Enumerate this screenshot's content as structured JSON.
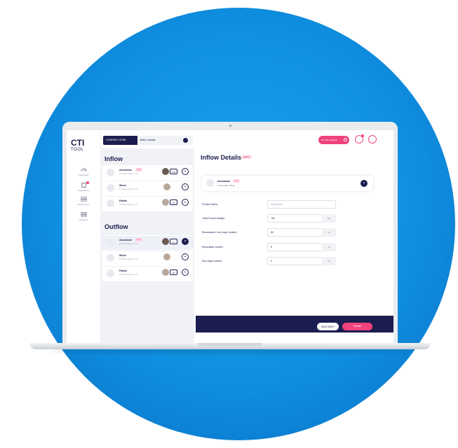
{
  "app": {
    "logo_line1": "CTI",
    "logo_line2": "TOOL"
  },
  "sidebar": {
    "items": [
      {
        "label": "Dashboard",
        "icon": "dashboard-icon"
      },
      {
        "label": "Organization",
        "icon": "organization-icon"
      },
      {
        "label": "Carbon flows",
        "icon": "flows-icon"
      },
      {
        "label": "Suppliers",
        "icon": "suppliers-icon"
      }
    ]
  },
  "header": {
    "company_level_label": "COMPANY LEVEL",
    "company_name": "Batio Graafas",
    "support_label": "Provide feedback",
    "colors": {
      "navy": "#1c1d4f",
      "pink": "#f0437e"
    }
  },
  "inflow": {
    "title": "Inflow",
    "items": [
      {
        "name": "Aluminium",
        "draft": "DRAFT",
        "meta": "15 shared views, 2 min",
        "count": "2016"
      },
      {
        "name": "Wood",
        "meta": "15 shared views, 2 min"
      },
      {
        "name": "Plastic",
        "meta": "15 shared views, 2 min",
        "count": "56"
      }
    ]
  },
  "outflow": {
    "title": "Outflow",
    "items": [
      {
        "name": "Aluminium",
        "draft": "DRAFT",
        "meta": "15 shared views, 2 min",
        "count": "14"
      },
      {
        "name": "Wood",
        "meta": "15 shared views, 2 min"
      },
      {
        "name": "Plastic",
        "meta": "15 shared views, 2 min",
        "count": "56"
      }
    ]
  },
  "detail": {
    "title": "Inflow Details",
    "badge": "DRAFT",
    "selected": {
      "name": "Aluminium",
      "draft": "DRAFT",
      "meta": "Total weight: 750 kg"
    },
    "fields": [
      {
        "label": "Product Name",
        "value": "Aluminium",
        "unit": ""
      },
      {
        "label": "Total Product Weight",
        "value": "750",
        "unit": "KG"
      },
      {
        "label": "Renewable & non virgin content",
        "value": "80",
        "unit": "%"
      },
      {
        "label": "Recyclable content",
        "value": "5",
        "unit": "%"
      },
      {
        "label": "Non virgin content",
        "value": "0",
        "unit": "%"
      }
    ],
    "save_label": "SAVE DRAFT",
    "publish_label": "Publish"
  }
}
